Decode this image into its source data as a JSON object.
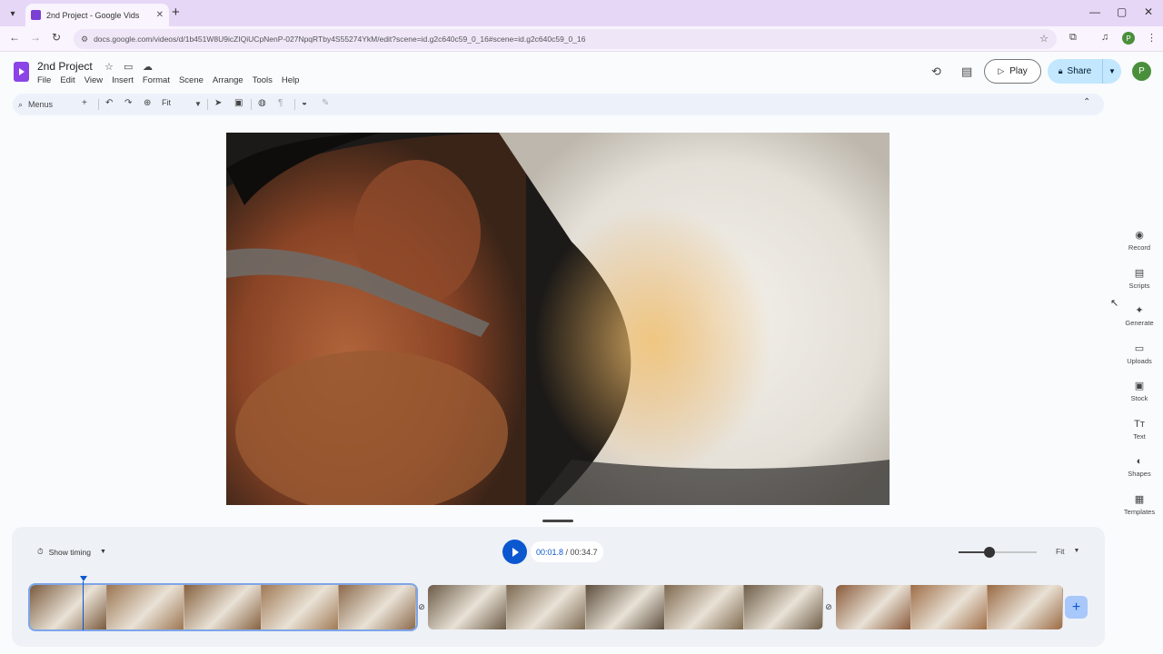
{
  "browser": {
    "tab_title": "2nd Project - Google Vids",
    "tab_close": "✕",
    "new_tab": "+",
    "url": "docs.google.com/videos/d/1b451W8U9icZIQiUCpNenP-027NpqRTby4S55274YkM/edit?scene=id.g2c640c59_0_16#scene=id.g2c640c59_0_16",
    "profile_initial": "P"
  },
  "app": {
    "doc_title": "2nd Project",
    "menus": [
      "File",
      "Edit",
      "View",
      "Insert",
      "Format",
      "Scene",
      "Arrange",
      "Tools",
      "Help"
    ],
    "play_label": "Play",
    "share_label": "Share",
    "avatar_initial": "P",
    "accent_color": "#0b57d0",
    "share_color": "#c2e7ff"
  },
  "toolbar": {
    "menus_label": "Menus",
    "zoom_label": "Fit"
  },
  "side_panel": {
    "items": [
      {
        "label": "Record",
        "icon": "record-icon",
        "glyph": "◉"
      },
      {
        "label": "Scripts",
        "icon": "scripts-icon",
        "glyph": "▤"
      },
      {
        "label": "Generate",
        "icon": "generate-icon",
        "glyph": "✦"
      },
      {
        "label": "Uploads",
        "icon": "uploads-icon",
        "glyph": "▭"
      },
      {
        "label": "Stock",
        "icon": "stock-icon",
        "glyph": "▣"
      },
      {
        "label": "Text",
        "icon": "text-icon",
        "glyph": "Tт"
      },
      {
        "label": "Shapes",
        "icon": "shapes-icon",
        "glyph": "◐"
      },
      {
        "label": "Templates",
        "icon": "templates-icon",
        "glyph": "▦"
      }
    ]
  },
  "timeline": {
    "show_timing_label": "Show timing",
    "current_time": "00:01.8",
    "separator": " / ",
    "total_time": "00:34.7",
    "fit_label": "Fit",
    "zoom_level": 0.4,
    "scenes": [
      {
        "name": "scene-1",
        "thumbs": 5,
        "colors": [
          "#7a5a3e",
          "#9c7652",
          "#86613f",
          "#a07a55",
          "#8c6a4c"
        ]
      },
      {
        "name": "scene-2",
        "thumbs": 5,
        "colors": [
          "#6b5a46",
          "#7d6a52",
          "#5e4f3e",
          "#806a50",
          "#6f5d48"
        ]
      },
      {
        "name": "scene-3",
        "thumbs": 3,
        "colors": [
          "#8a5a3a",
          "#a06e48",
          "#9a6a44"
        ]
      }
    ]
  }
}
